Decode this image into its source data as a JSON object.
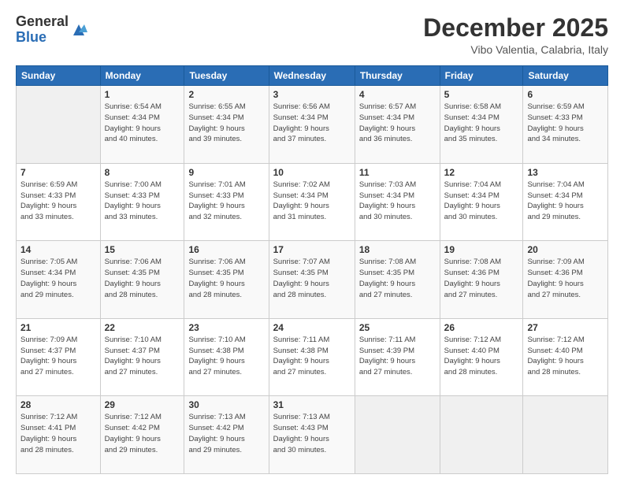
{
  "logo": {
    "general": "General",
    "blue": "Blue"
  },
  "header": {
    "month": "December 2025",
    "location": "Vibo Valentia, Calabria, Italy"
  },
  "days_of_week": [
    "Sunday",
    "Monday",
    "Tuesday",
    "Wednesday",
    "Thursday",
    "Friday",
    "Saturday"
  ],
  "weeks": [
    [
      {
        "day": "",
        "info": ""
      },
      {
        "day": "1",
        "info": "Sunrise: 6:54 AM\nSunset: 4:34 PM\nDaylight: 9 hours\nand 40 minutes."
      },
      {
        "day": "2",
        "info": "Sunrise: 6:55 AM\nSunset: 4:34 PM\nDaylight: 9 hours\nand 39 minutes."
      },
      {
        "day": "3",
        "info": "Sunrise: 6:56 AM\nSunset: 4:34 PM\nDaylight: 9 hours\nand 37 minutes."
      },
      {
        "day": "4",
        "info": "Sunrise: 6:57 AM\nSunset: 4:34 PM\nDaylight: 9 hours\nand 36 minutes."
      },
      {
        "day": "5",
        "info": "Sunrise: 6:58 AM\nSunset: 4:34 PM\nDaylight: 9 hours\nand 35 minutes."
      },
      {
        "day": "6",
        "info": "Sunrise: 6:59 AM\nSunset: 4:33 PM\nDaylight: 9 hours\nand 34 minutes."
      }
    ],
    [
      {
        "day": "7",
        "info": "Sunrise: 6:59 AM\nSunset: 4:33 PM\nDaylight: 9 hours\nand 33 minutes."
      },
      {
        "day": "8",
        "info": "Sunrise: 7:00 AM\nSunset: 4:33 PM\nDaylight: 9 hours\nand 33 minutes."
      },
      {
        "day": "9",
        "info": "Sunrise: 7:01 AM\nSunset: 4:33 PM\nDaylight: 9 hours\nand 32 minutes."
      },
      {
        "day": "10",
        "info": "Sunrise: 7:02 AM\nSunset: 4:34 PM\nDaylight: 9 hours\nand 31 minutes."
      },
      {
        "day": "11",
        "info": "Sunrise: 7:03 AM\nSunset: 4:34 PM\nDaylight: 9 hours\nand 30 minutes."
      },
      {
        "day": "12",
        "info": "Sunrise: 7:04 AM\nSunset: 4:34 PM\nDaylight: 9 hours\nand 30 minutes."
      },
      {
        "day": "13",
        "info": "Sunrise: 7:04 AM\nSunset: 4:34 PM\nDaylight: 9 hours\nand 29 minutes."
      }
    ],
    [
      {
        "day": "14",
        "info": "Sunrise: 7:05 AM\nSunset: 4:34 PM\nDaylight: 9 hours\nand 29 minutes."
      },
      {
        "day": "15",
        "info": "Sunrise: 7:06 AM\nSunset: 4:35 PM\nDaylight: 9 hours\nand 28 minutes."
      },
      {
        "day": "16",
        "info": "Sunrise: 7:06 AM\nSunset: 4:35 PM\nDaylight: 9 hours\nand 28 minutes."
      },
      {
        "day": "17",
        "info": "Sunrise: 7:07 AM\nSunset: 4:35 PM\nDaylight: 9 hours\nand 28 minutes."
      },
      {
        "day": "18",
        "info": "Sunrise: 7:08 AM\nSunset: 4:35 PM\nDaylight: 9 hours\nand 27 minutes."
      },
      {
        "day": "19",
        "info": "Sunrise: 7:08 AM\nSunset: 4:36 PM\nDaylight: 9 hours\nand 27 minutes."
      },
      {
        "day": "20",
        "info": "Sunrise: 7:09 AM\nSunset: 4:36 PM\nDaylight: 9 hours\nand 27 minutes."
      }
    ],
    [
      {
        "day": "21",
        "info": "Sunrise: 7:09 AM\nSunset: 4:37 PM\nDaylight: 9 hours\nand 27 minutes."
      },
      {
        "day": "22",
        "info": "Sunrise: 7:10 AM\nSunset: 4:37 PM\nDaylight: 9 hours\nand 27 minutes."
      },
      {
        "day": "23",
        "info": "Sunrise: 7:10 AM\nSunset: 4:38 PM\nDaylight: 9 hours\nand 27 minutes."
      },
      {
        "day": "24",
        "info": "Sunrise: 7:11 AM\nSunset: 4:38 PM\nDaylight: 9 hours\nand 27 minutes."
      },
      {
        "day": "25",
        "info": "Sunrise: 7:11 AM\nSunset: 4:39 PM\nDaylight: 9 hours\nand 27 minutes."
      },
      {
        "day": "26",
        "info": "Sunrise: 7:12 AM\nSunset: 4:40 PM\nDaylight: 9 hours\nand 28 minutes."
      },
      {
        "day": "27",
        "info": "Sunrise: 7:12 AM\nSunset: 4:40 PM\nDaylight: 9 hours\nand 28 minutes."
      }
    ],
    [
      {
        "day": "28",
        "info": "Sunrise: 7:12 AM\nSunset: 4:41 PM\nDaylight: 9 hours\nand 28 minutes."
      },
      {
        "day": "29",
        "info": "Sunrise: 7:12 AM\nSunset: 4:42 PM\nDaylight: 9 hours\nand 29 minutes."
      },
      {
        "day": "30",
        "info": "Sunrise: 7:13 AM\nSunset: 4:42 PM\nDaylight: 9 hours\nand 29 minutes."
      },
      {
        "day": "31",
        "info": "Sunrise: 7:13 AM\nSunset: 4:43 PM\nDaylight: 9 hours\nand 30 minutes."
      },
      {
        "day": "",
        "info": ""
      },
      {
        "day": "",
        "info": ""
      },
      {
        "day": "",
        "info": ""
      }
    ]
  ]
}
